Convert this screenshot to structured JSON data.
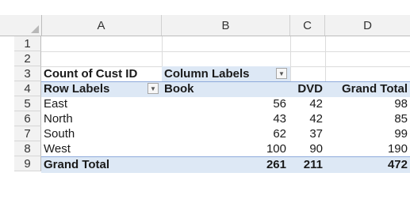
{
  "columns": [
    "A",
    "B",
    "C",
    "D"
  ],
  "rows": [
    "1",
    "2",
    "3",
    "4",
    "5",
    "6",
    "7",
    "8",
    "9"
  ],
  "pivot": {
    "values_label": "Count of Cust ID",
    "column_labels": "Column Labels",
    "row_labels": "Row Labels",
    "headers": [
      "Book",
      "DVD",
      "Grand Total"
    ],
    "data_rows": [
      {
        "label": "East",
        "book": "56",
        "dvd": "42",
        "total": "98"
      },
      {
        "label": "North",
        "book": "43",
        "dvd": "42",
        "total": "85"
      },
      {
        "label": "South",
        "book": "62",
        "dvd": "37",
        "total": "99"
      },
      {
        "label": "West",
        "book": "100",
        "dvd": "90",
        "total": "190"
      }
    ],
    "grand_total": {
      "label": "Grand Total",
      "book": "261",
      "dvd": "211",
      "total": "472"
    }
  },
  "icons": {
    "filter_dropdown": "chevron-down-icon",
    "select_all": "select-all-triangle-icon"
  },
  "colors": {
    "pivot_band": "#dde8f5",
    "header_bg": "#f2f2f2"
  }
}
